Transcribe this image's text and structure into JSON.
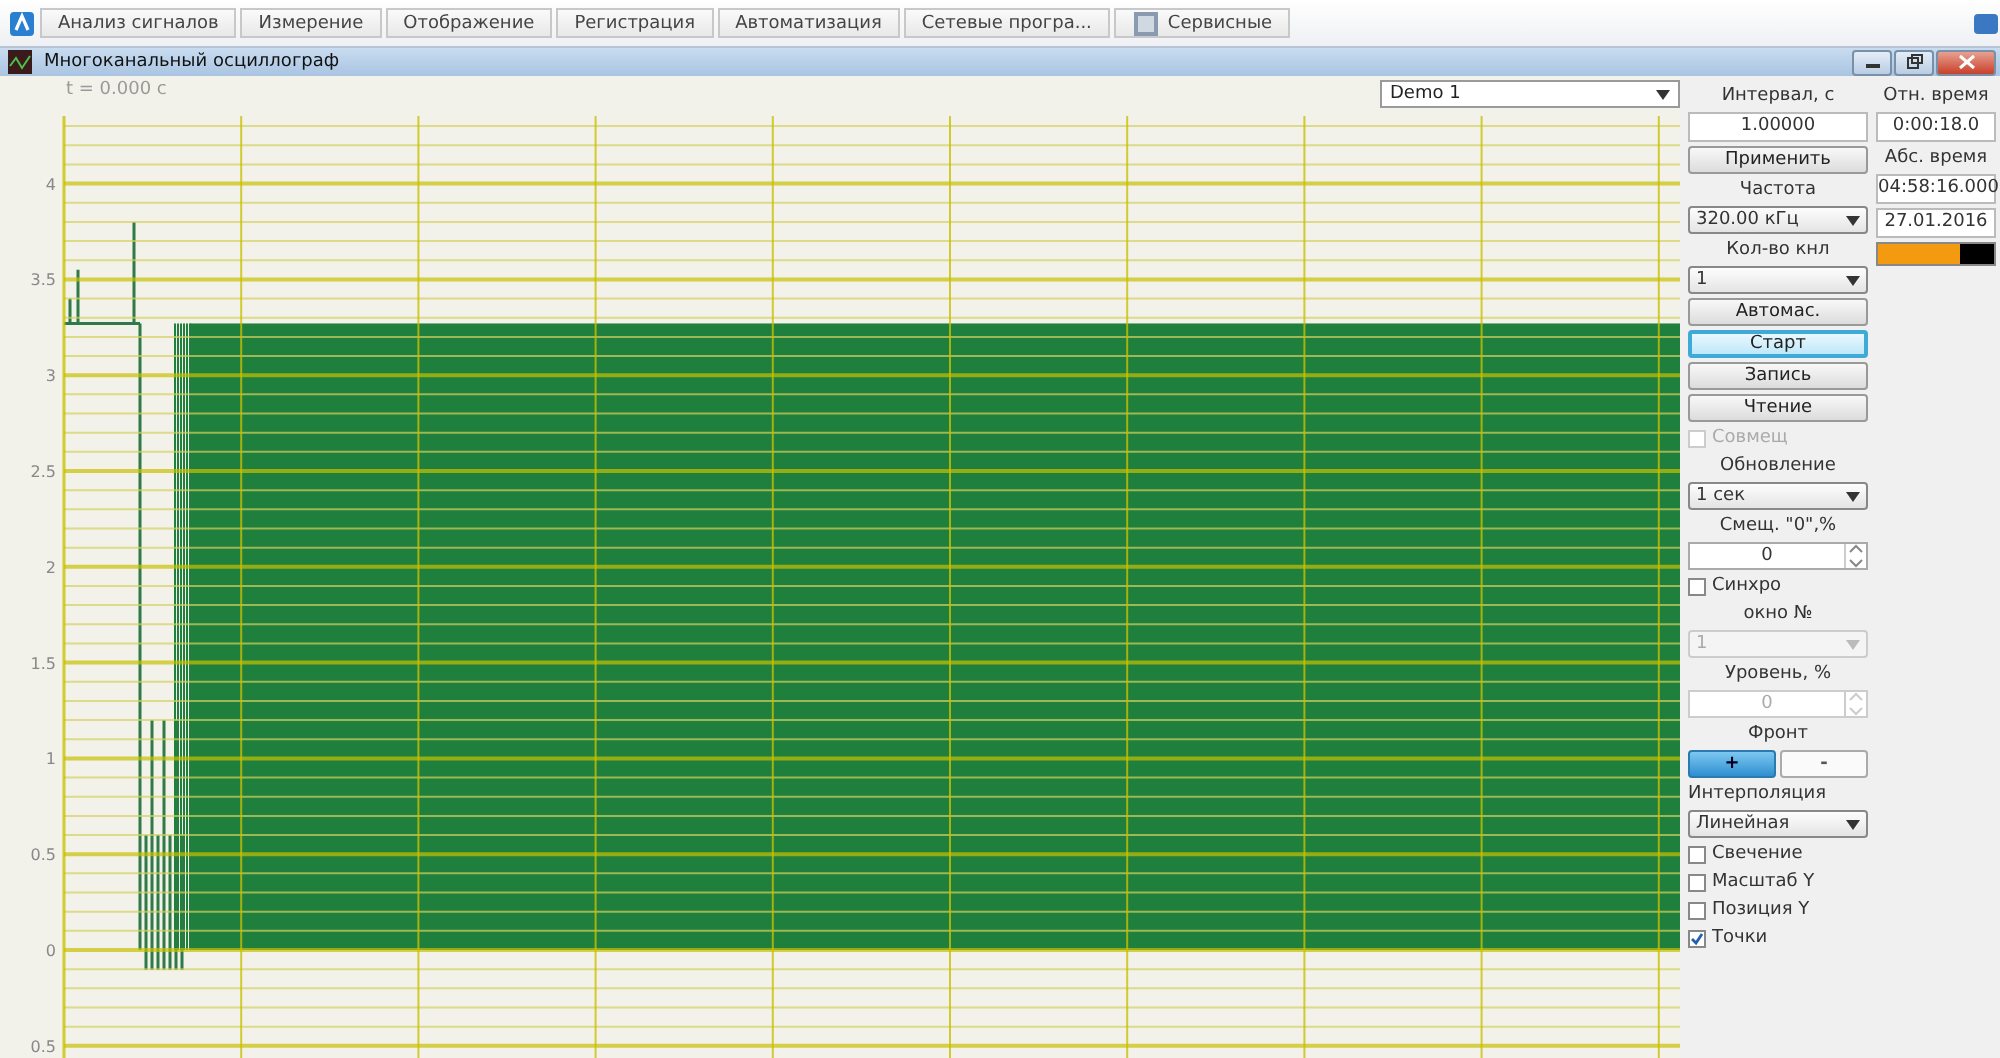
{
  "toolbar": {
    "tabs": [
      {
        "label": "Анализ сигналов",
        "kind": "app"
      },
      {
        "label": "Измерение",
        "kind": "plain"
      },
      {
        "label": "Отображение",
        "kind": "plain"
      },
      {
        "label": "Регистрация",
        "kind": "plain"
      },
      {
        "label": "Автоматизация",
        "kind": "plain"
      },
      {
        "label": "Сетевые програ...",
        "kind": "plain"
      },
      {
        "label": "Сервисные",
        "kind": "tool"
      }
    ]
  },
  "window": {
    "title": "Многоканальный осциллограф"
  },
  "plot": {
    "time_label": "t = 0.000 с",
    "channel_select": "Demo 1",
    "y_tick_labels": [
      "4",
      "3.5",
      "3",
      "2.5",
      "2",
      "1.5",
      "1",
      "0.5",
      "0",
      "0.5"
    ]
  },
  "panel": {
    "controls": [
      {
        "kind": "label",
        "text": "Интервал, с"
      },
      {
        "kind": "field",
        "text": "1.00000"
      },
      {
        "kind": "button",
        "text": "Применить",
        "selected": false
      },
      {
        "kind": "label",
        "text": "Частота"
      },
      {
        "kind": "select",
        "text": "320.00 кГц",
        "disabled": false
      },
      {
        "kind": "label",
        "text": "Кол-во кнл"
      },
      {
        "kind": "select",
        "text": "1",
        "disabled": false
      },
      {
        "kind": "button",
        "text": "Автомас.",
        "selected": false
      },
      {
        "kind": "button",
        "text": "Старт",
        "selected": true
      },
      {
        "kind": "button",
        "text": "Запись",
        "selected": false
      },
      {
        "kind": "button",
        "text": "Чтение",
        "selected": false
      },
      {
        "kind": "checkbox",
        "text": "Совмещ",
        "checked": false,
        "disabled": true
      },
      {
        "kind": "label",
        "text": "Обновление"
      },
      {
        "kind": "select",
        "text": "1 сек",
        "disabled": false
      },
      {
        "kind": "label",
        "text": "Смещ. \"0\",%"
      },
      {
        "kind": "spinner",
        "text": "0",
        "disabled": false
      },
      {
        "kind": "checkbox",
        "text": "Синхро",
        "checked": false,
        "disabled": false
      },
      {
        "kind": "label",
        "text": "окно №"
      },
      {
        "kind": "select",
        "text": "1",
        "disabled": true
      },
      {
        "kind": "label",
        "text": "Уровень, %"
      },
      {
        "kind": "spinner",
        "text": "0",
        "disabled": true
      },
      {
        "kind": "label",
        "text": "Фронт"
      },
      {
        "kind": "pair",
        "buttons": [
          {
            "label": "+",
            "selected": true
          },
          {
            "label": "-",
            "selected": false
          }
        ]
      },
      {
        "kind": "caption",
        "text": "Интерполяция"
      },
      {
        "kind": "select",
        "text": "Линейная",
        "disabled": false
      },
      {
        "kind": "checkbox",
        "text": "Свечение",
        "checked": false,
        "disabled": false
      },
      {
        "kind": "checkbox",
        "text": "Масштаб Y",
        "checked": false,
        "disabled": false
      },
      {
        "kind": "checkbox",
        "text": "Позиция Y",
        "checked": false,
        "disabled": false
      },
      {
        "kind": "checkbox",
        "text": "Точки",
        "checked": true,
        "disabled": false
      }
    ]
  },
  "time": {
    "rel_label": "Отн. время",
    "rel_value": "0:00:18.0",
    "abs_label": "Абс. время",
    "abs_value": "04:58:16.000",
    "date": "27.01.2016",
    "level": 0.7
  }
}
